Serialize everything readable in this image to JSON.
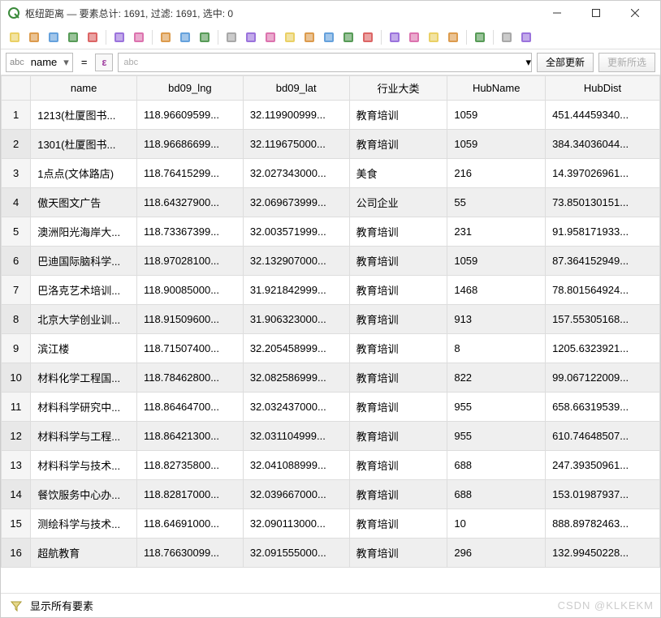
{
  "title": "枢纽距离 — 要素总计: 1691, 过滤: 1691, 选中: 0",
  "filter": {
    "field_prefix": "abc",
    "field_value": "name",
    "expr_prefix": "abc",
    "expr_value": "",
    "update_all": "全部更新",
    "update_selected": "更新所选"
  },
  "epsilon": "ε",
  "equals": "=",
  "columns": [
    "name",
    "bd09_lng",
    "bd09_lat",
    "行业大类",
    "HubName",
    "HubDist"
  ],
  "rows": [
    {
      "n": "1",
      "name": "1213(杜厦图书...",
      "lng": "118.96609599...",
      "lat": "32.119900999...",
      "cat": "教育培训",
      "hub": "1059",
      "dist": "451.44459340..."
    },
    {
      "n": "2",
      "name": "1301(杜厦图书...",
      "lng": "118.96686699...",
      "lat": "32.119675000...",
      "cat": "教育培训",
      "hub": "1059",
      "dist": "384.34036044..."
    },
    {
      "n": "3",
      "name": "1点点(文体路店)",
      "lng": "118.76415299...",
      "lat": "32.027343000...",
      "cat": "美食",
      "hub": "216",
      "dist": "14.397026961..."
    },
    {
      "n": "4",
      "name": "傲天图文广告",
      "lng": "118.64327900...",
      "lat": "32.069673999...",
      "cat": "公司企业",
      "hub": "55",
      "dist": "73.850130151..."
    },
    {
      "n": "5",
      "name": "澳洲阳光海岸大...",
      "lng": "118.73367399...",
      "lat": "32.003571999...",
      "cat": "教育培训",
      "hub": "231",
      "dist": "91.958171933..."
    },
    {
      "n": "6",
      "name": "巴迪国际脑科学...",
      "lng": "118.97028100...",
      "lat": "32.132907000...",
      "cat": "教育培训",
      "hub": "1059",
      "dist": "87.364152949..."
    },
    {
      "n": "7",
      "name": "巴洛克艺术培训...",
      "lng": "118.90085000...",
      "lat": "31.921842999...",
      "cat": "教育培训",
      "hub": "1468",
      "dist": "78.801564924..."
    },
    {
      "n": "8",
      "name": "北京大学创业训...",
      "lng": "118.91509600...",
      "lat": "31.906323000...",
      "cat": "教育培训",
      "hub": "913",
      "dist": "157.55305168..."
    },
    {
      "n": "9",
      "name": "滨江楼",
      "lng": "118.71507400...",
      "lat": "32.205458999...",
      "cat": "教育培训",
      "hub": "8",
      "dist": "1205.6323921..."
    },
    {
      "n": "10",
      "name": "材料化学工程国...",
      "lng": "118.78462800...",
      "lat": "32.082586999...",
      "cat": "教育培训",
      "hub": "822",
      "dist": "99.067122009..."
    },
    {
      "n": "11",
      "name": "材料科学研究中...",
      "lng": "118.86464700...",
      "lat": "32.032437000...",
      "cat": "教育培训",
      "hub": "955",
      "dist": "658.66319539..."
    },
    {
      "n": "12",
      "name": "材料科学与工程...",
      "lng": "118.86421300...",
      "lat": "32.031104999...",
      "cat": "教育培训",
      "hub": "955",
      "dist": "610.74648507..."
    },
    {
      "n": "13",
      "name": "材料科学与技术...",
      "lng": "118.82735800...",
      "lat": "32.041088999...",
      "cat": "教育培训",
      "hub": "688",
      "dist": "247.39350961..."
    },
    {
      "n": "14",
      "name": "餐饮服务中心办...",
      "lng": "118.82817000...",
      "lat": "32.039667000...",
      "cat": "教育培训",
      "hub": "688",
      "dist": "153.01987937..."
    },
    {
      "n": "15",
      "name": "测绘科学与技术...",
      "lng": "118.64691000...",
      "lat": "32.090113000...",
      "cat": "教育培训",
      "hub": "10",
      "dist": "888.89782463..."
    },
    {
      "n": "16",
      "name": "超航教育",
      "lng": "118.76630099...",
      "lat": "32.091555000...",
      "cat": "教育培训",
      "hub": "296",
      "dist": "132.99450228..."
    }
  ],
  "footer": {
    "show_all": "显示所有要素"
  },
  "watermark": "CSDN @KLKEKM",
  "toolbar_icons": [
    "pencil-icon",
    "toggle-edit-icon",
    "save-edits-icon",
    "add-feature-icon",
    "refresh-icon",
    "separator",
    "new-row-icon",
    "delete-row-icon",
    "separator",
    "cut-icon",
    "copy-icon",
    "paste-icon",
    "separator",
    "expression-select-icon",
    "select-all-icon",
    "invert-select-icon",
    "deselect-icon",
    "filter-select-icon",
    "move-top-icon",
    "pan-to-icon",
    "zoom-to-icon",
    "separator",
    "new-field-icon",
    "delete-field-icon",
    "organize-columns-icon",
    "field-calc-icon",
    "separator",
    "conditional-format-icon",
    "separator",
    "dock-icon",
    "actions-icon"
  ],
  "icon_colors": [
    "#e6c84a",
    "#d68a2e",
    "#4a90d6",
    "#3a8a3a",
    "#d64a4a",
    "#999",
    "#8a5ad6",
    "#d65aa0"
  ]
}
